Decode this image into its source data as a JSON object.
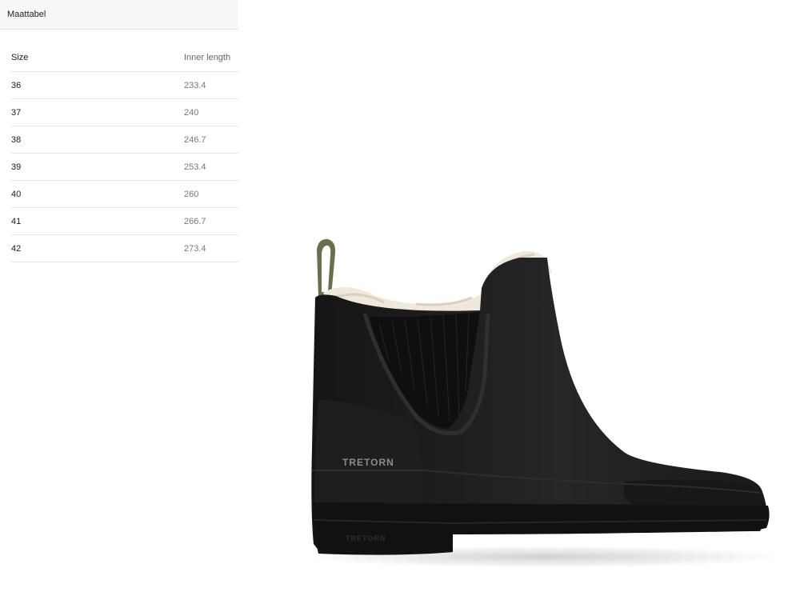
{
  "panel": {
    "title": "Maattabel"
  },
  "table": {
    "headers": [
      "Size",
      "Inner length"
    ],
    "rows": [
      {
        "size": "36",
        "length": "233.4"
      },
      {
        "size": "37",
        "length": "240"
      },
      {
        "size": "38",
        "length": "246.7"
      },
      {
        "size": "39",
        "length": "253.4"
      },
      {
        "size": "40",
        "length": "260"
      },
      {
        "size": "41",
        "length": "266.7"
      },
      {
        "size": "42",
        "length": "273.4"
      }
    ]
  },
  "product": {
    "brand": "TRETORN"
  },
  "colors": {
    "boot": "#1c1c1c",
    "pull_tab": "#6b6e4a",
    "lining": "#efe9dc"
  }
}
